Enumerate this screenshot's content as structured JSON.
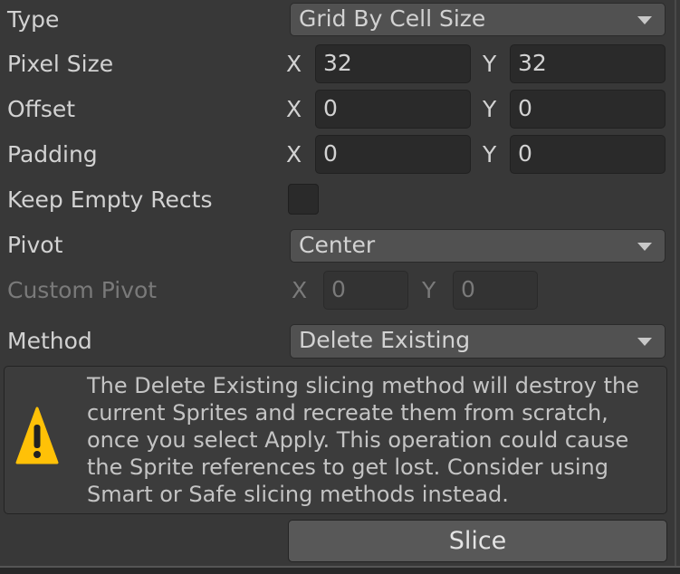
{
  "type": {
    "label": "Type",
    "value": "Grid By Cell Size"
  },
  "pixel_size": {
    "label": "Pixel Size",
    "x_label": "X",
    "x": "32",
    "y_label": "Y",
    "y": "32"
  },
  "offset": {
    "label": "Offset",
    "x_label": "X",
    "x": "0",
    "y_label": "Y",
    "y": "0"
  },
  "padding": {
    "label": "Padding",
    "x_label": "X",
    "x": "0",
    "y_label": "Y",
    "y": "0"
  },
  "keep_empty_rects": {
    "label": "Keep Empty Rects",
    "checked": false
  },
  "pivot": {
    "label": "Pivot",
    "value": "Center"
  },
  "custom_pivot": {
    "label": "Custom Pivot",
    "x_label": "X",
    "x": "0",
    "y_label": "Y",
    "y": "0",
    "disabled": true
  },
  "method": {
    "label": "Method",
    "value": "Delete Existing"
  },
  "warning": {
    "icon": "warning-icon",
    "color": "#ffc107",
    "text": "The Delete Existing slicing method will destroy the current Sprites and recreate them from scratch, once you select Apply. This operation could cause the Sprite references to get lost. Consider using Smart or Safe slicing methods instead."
  },
  "slice_button": "Slice"
}
